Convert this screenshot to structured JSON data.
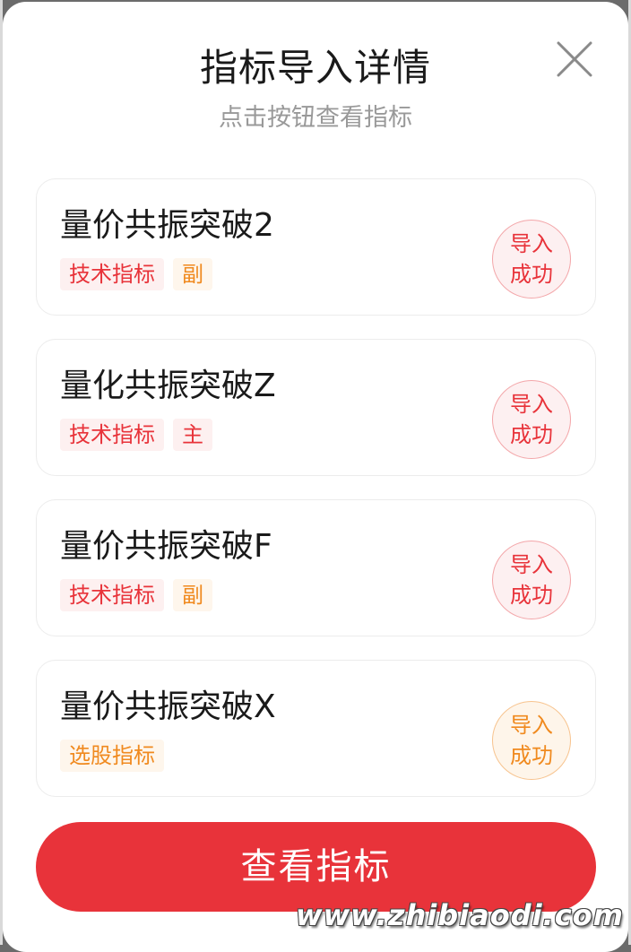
{
  "modal": {
    "title": "指标导入详情",
    "subtitle": "点击按钮查看指标",
    "close_icon": "close-icon"
  },
  "indicators": [
    {
      "name": "量价共振突破2",
      "tags": [
        {
          "label": "技术指标",
          "color": "red"
        },
        {
          "label": "副",
          "color": "orange"
        }
      ],
      "status_line1": "导入",
      "status_line2": "成功",
      "status_color": "red"
    },
    {
      "name": "量化共振突破Z",
      "tags": [
        {
          "label": "技术指标",
          "color": "red"
        },
        {
          "label": "主",
          "color": "red"
        }
      ],
      "status_line1": "导入",
      "status_line2": "成功",
      "status_color": "red"
    },
    {
      "name": "量价共振突破F",
      "tags": [
        {
          "label": "技术指标",
          "color": "red"
        },
        {
          "label": "副",
          "color": "orange"
        }
      ],
      "status_line1": "导入",
      "status_line2": "成功",
      "status_color": "red"
    },
    {
      "name": "量价共振突破X",
      "tags": [
        {
          "label": "选股指标",
          "color": "orange"
        }
      ],
      "status_line1": "导入",
      "status_line2": "成功",
      "status_color": "orange"
    }
  ],
  "view_button": {
    "label": "查看指标"
  },
  "watermark": "www.zhibiaodi.com",
  "colors": {
    "accent_red": "#e8333a",
    "accent_orange": "#f08a1f"
  }
}
